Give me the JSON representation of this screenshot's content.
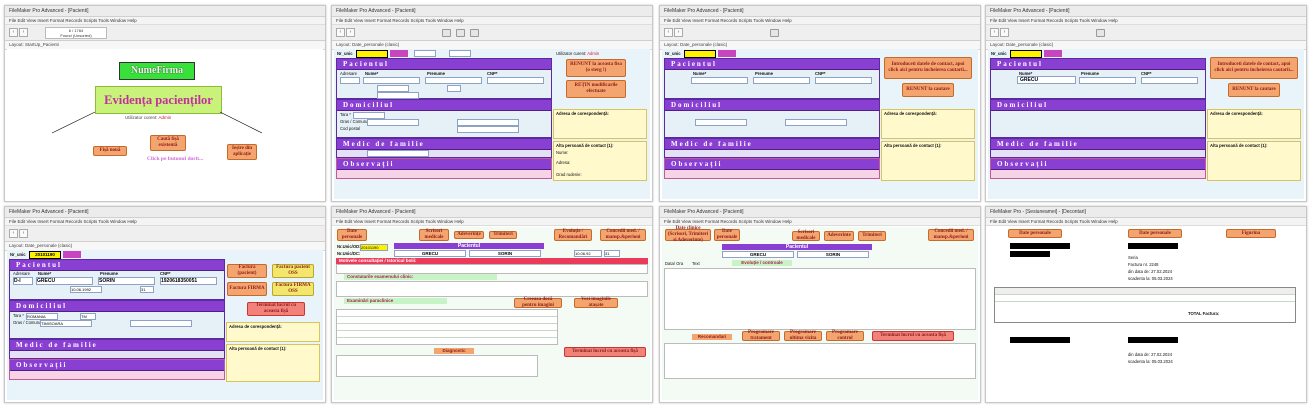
{
  "window": {
    "title": "FileMaker Pro Advanced - [Pacienti]",
    "menu": [
      "File",
      "Edit",
      "View",
      "Insert",
      "Format",
      "Records",
      "Scripts",
      "Tools",
      "Window",
      "Help"
    ],
    "toolbar_record": "6 / 1784",
    "toolbar_found": "Found (Unsorted)"
  },
  "panel1": {
    "layout_label": "Layout: StartUp_Pacienti",
    "brand": "NumeFirma",
    "title": "Evidența pacienților",
    "user_line_prefix": "Utilizator curent:",
    "user_name": "Admin",
    "btn_new": "Fișă nouă",
    "btn_search": "Caută fișă existentă",
    "btn_exit": "Ieșire din aplicație",
    "hint": "Click pe butonul dorit..."
  },
  "patient_form": {
    "nr_unic_label": "Nr_unic",
    "nr_unic_value": "20101190",
    "pacient_header": "Pacientul",
    "name_label": "Nume*",
    "surname_label": "Prenume",
    "cnp_label": "CNP*",
    "adresare_label": "Adresare",
    "domiciliu_header": "Domiciliul",
    "tara_label": "Tara *",
    "tara_value": "ROMANIA",
    "judet_label": "Judet",
    "oras_label": "Oras / Comuna",
    "strada_label": "Strada / Satul",
    "cod_postal_label": "Cod postal",
    "fax_label": "Fax",
    "email_label": "E-mail",
    "tel_acasa": "Tel_acasa",
    "tel_mobil": "Tel_mobil",
    "tel_serviciu": "Tel_serviciu",
    "medic_header": "Medic de familie",
    "medic_name_label": "Nume & Prenume:",
    "tel_label": "Tel:",
    "adresa_cabinet": "Adresa cabinet medical:",
    "obs_header": "Observații",
    "adresa_corespondenta": "Adresa de corespondență:",
    "alte_persoane": "Alta persoană de contact (1):",
    "nume_label": "Nume:",
    "adresa_label": "Adresa:",
    "grad_rudenie": "Grad rudenie:"
  },
  "panel2": {
    "btn1": "RENUNT la aceasta fisa (o sterg !)",
    "btn2": "REȚIN modificarile efectuate",
    "user_prefix": "Utilizator curent:",
    "user_name": "Admin"
  },
  "panel3": {
    "btn_intro": "Introduceti datele de contact, apoi click aici pentru incheierea cautarii...",
    "btn_renunt": "RENUNT la cautare"
  },
  "panel4": {
    "name_value": "GRECU",
    "btn_intro": "Introduceti datele de contact, apoi click aici pentru incheierea cautarii...",
    "btn_renunt": "RENUNT la cautare"
  },
  "panel5": {
    "name_value": "GRECU",
    "surname_value": "SORIN",
    "cnp_value": "1920618350051",
    "adresare_value": "D-l",
    "data_nasterii": "10.06.1992",
    "varsta": "31",
    "judet_value": "TM",
    "oras_value": "TIMISOARA",
    "btn_factura_pf": "Factura (pacient)",
    "btn_factura_pf_oss": "Factura pacient OSS",
    "btn_factura_firma": "Factura FIRMA",
    "btn_factura_firma_oss": "Factura FIRMA OSS",
    "btn_terminat": "Terminat lucrul cu aceasta fișă"
  },
  "panel6": {
    "btn_date": "Date personale",
    "btn_scrisori": "Scrisori medicale",
    "btn_adeverinte": "Adeverințe",
    "btn_trimiteri": "Trimiteri",
    "btn_evolutie": "Evoluție / Recomandări",
    "btn_concedii": "Concedii med. / mansp.&perioni",
    "nr_unic_od": "Nr.Unic/OD:",
    "nr_unic_od_value": "20101190",
    "nr_fisa": "Nr.Unic/DC:",
    "name": "GRECU",
    "surname": "SORIN",
    "dob": "10.06.92",
    "varsta": "31",
    "motivele": "Motivele consultației / Istoricul bolii:",
    "constatari": "Constatarile examenului clinic:",
    "examinari": "Examinări paraclinice",
    "btn_creeaza": "Creeaza doză pentru imagini",
    "btn_vezi": "Vezi imaginile atașate",
    "diagnostic_label": "Diagnostic",
    "btn_terminat": "Terminat lucrul cu aceasta fișă"
  },
  "panel7": {
    "btn_date_clinice": "Date clinice (Scrisori, Trimiteri si Adeverinte)",
    "btn_date": "Date personale",
    "btn_scrisori": "Scrisori medicale",
    "btn_adeverinte": "Adeverinte",
    "btn_trimiteri": "Trimiteri",
    "btn_concedii": "Concedii med. / mansp.&perioni",
    "name": "GRECU",
    "surname": "SORIN",
    "evolutie": "Evoluție / controale",
    "recomandari": "Recomandari",
    "btn_prog1": "Programare tratament",
    "btn_prog2": "Programare ultima vizita",
    "btn_prog3": "Programare control",
    "btn_terminat": "Terminat lucrul cu aceasta fișă",
    "data_col": "Data/ Ora",
    "text_col": "Text"
  },
  "panel8": {
    "title": "FileMaker Pro - [Sesiuneamei] - [Decontari]",
    "btn_date": "Date personale",
    "btn_date2": "Date personale",
    "fisa": "Figurina",
    "seria": "Seria",
    "factura": "Factura nr.",
    "factura_num": "2248",
    "din_data": "din data de:",
    "din_data_val": "27.02.2024",
    "scadenta": "scadenta la:",
    "scadenta_val": "05.03.2024",
    "total": "TOTAL Factura:"
  },
  "colors": {
    "header_purple": "#8a3fd3",
    "orange_button": "#f4a46e",
    "highlight_yellow": "#fff9cc",
    "section_blue": "#e5f1f7",
    "accent_red": "#d0182b"
  }
}
